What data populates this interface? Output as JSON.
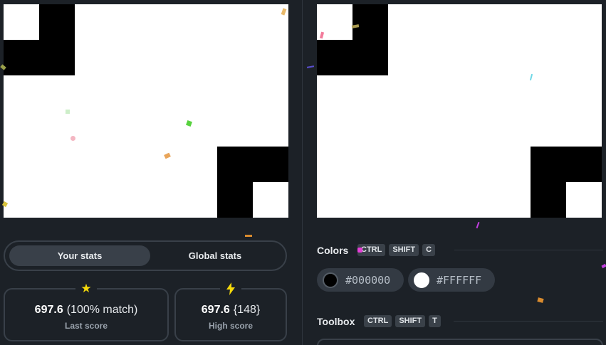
{
  "stats_tabs": {
    "active": "Your stats",
    "inactive": "Global stats"
  },
  "last_score": {
    "value": "697.6",
    "detail": "(100% match)",
    "label": "Last score",
    "icon": "star-icon"
  },
  "high_score": {
    "value": "697.6",
    "detail": "{148}",
    "label": "High score",
    "icon": "lightning-icon"
  },
  "colors_section": {
    "title": "Colors",
    "shortcut": [
      "CTRL",
      "SHIFT",
      "C"
    ],
    "swatches": [
      {
        "hex": "#000000",
        "color": "#000000"
      },
      {
        "hex": "#FFFFFF",
        "color": "#ffffff"
      }
    ]
  },
  "toolbox_section": {
    "title": "Toolbox",
    "shortcut": [
      "CTRL",
      "SHIFT",
      "T"
    ]
  },
  "theme": {
    "background": "#1c2127",
    "panel_border": "#394049",
    "accent": "#f5d90a"
  }
}
